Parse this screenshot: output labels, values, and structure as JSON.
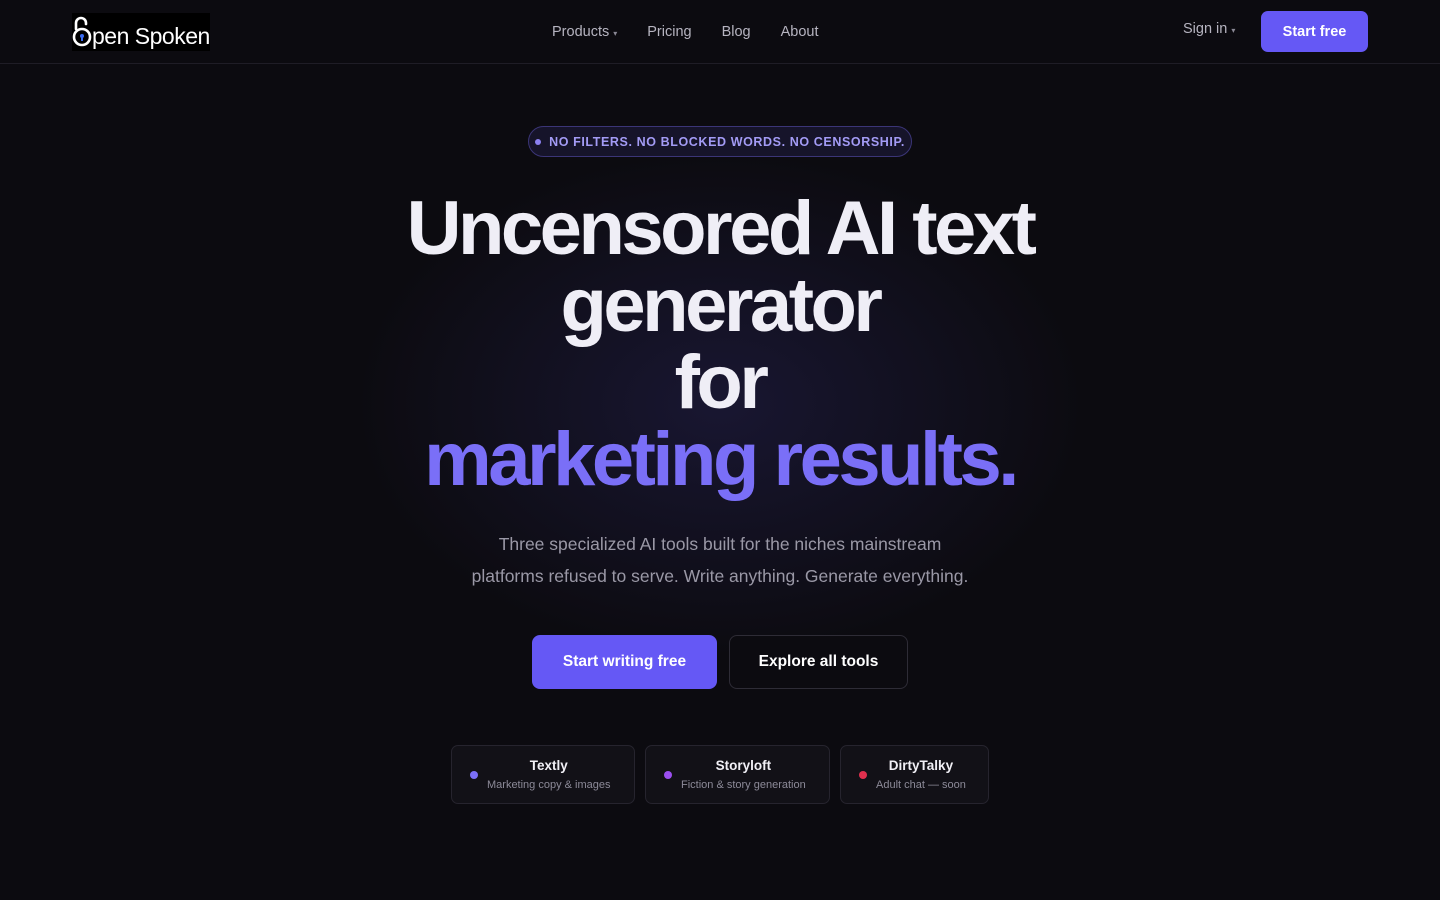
{
  "brand": {
    "name": "Open Spoken",
    "name_text": "pen Spoken"
  },
  "nav": {
    "links": [
      {
        "label": "Products",
        "has_dropdown": true
      },
      {
        "label": "Pricing",
        "has_dropdown": false
      },
      {
        "label": "Blog",
        "has_dropdown": false
      },
      {
        "label": "About",
        "has_dropdown": false
      }
    ],
    "signin_label": "Sign in",
    "cta_label": "Start free"
  },
  "hero": {
    "badge": "NO FILTERS. NO BLOCKED WORDS. NO CENSORSHIP.",
    "headline_lines": [
      "Uncensored AI text",
      "generator",
      "for"
    ],
    "headline_accent": "marketing results.",
    "subtitle_line1": "Three specialized AI tools built for the niches mainstream",
    "subtitle_line2": "platforms refused to serve. Write anything. Generate everything.",
    "primary_cta": "Start writing free",
    "secondary_cta": "Explore all tools"
  },
  "tools": [
    {
      "name": "Textly",
      "desc": "Marketing copy & images",
      "dot_color": "#7b6ff7"
    },
    {
      "name": "Storyloft",
      "desc": "Fiction & story generation",
      "dot_color": "#9b4ff0"
    },
    {
      "name": "DirtyTalky",
      "desc": "Adult chat — soon",
      "dot_color": "#e0304e"
    }
  ],
  "colors": {
    "background": "#0c0b10",
    "accent": "#6558f5",
    "accent_text": "#7a6ff7",
    "badge_text": "#a39bf5"
  }
}
